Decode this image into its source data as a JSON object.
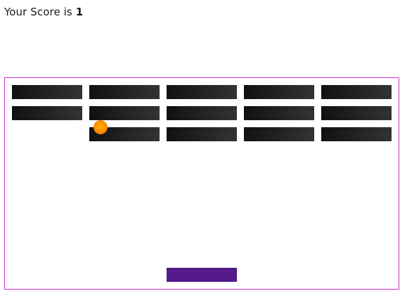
{
  "score": {
    "label": "Your Score is",
    "value": "1"
  },
  "board": {
    "border_color": "#cc33cc",
    "bricks": [
      {
        "row": 0,
        "col": 0
      },
      {
        "row": 0,
        "col": 1
      },
      {
        "row": 0,
        "col": 2
      },
      {
        "row": 0,
        "col": 3
      },
      {
        "row": 0,
        "col": 4
      },
      {
        "row": 1,
        "col": 0
      },
      {
        "row": 1,
        "col": 1
      },
      {
        "row": 1,
        "col": 2
      },
      {
        "row": 1,
        "col": 3
      },
      {
        "row": 1,
        "col": 4
      },
      {
        "row": 2,
        "col": 1
      },
      {
        "row": 2,
        "col": 2
      },
      {
        "row": 2,
        "col": 3
      },
      {
        "row": 2,
        "col": 4
      }
    ],
    "brick_color": "#1a1a1a",
    "ball_color": "#ff8a00",
    "paddle_color": "#541a8b"
  }
}
